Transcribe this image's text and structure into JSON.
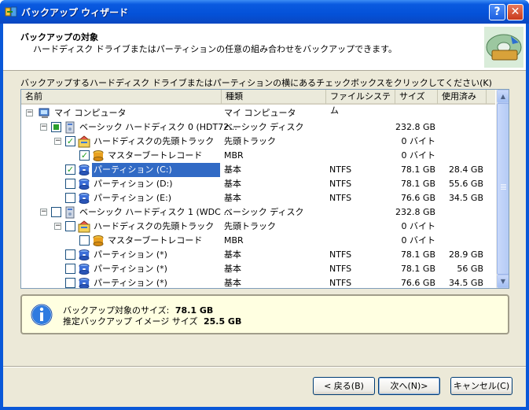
{
  "window": {
    "title": "バックアップ ウィザード",
    "help_label": "?",
    "close_label": "✕"
  },
  "header": {
    "title": "バックアップの対象",
    "subtitle": "ハードディスク ドライブまたはパーティションの任意の組み合わせをバックアップできます。"
  },
  "instruction": "バックアップするハードディスク ドライブまたはパーティションの横にあるチェックボックスをクリックしてください(K)",
  "columns": [
    "名前",
    "種類",
    "ファイルシステム",
    "サイズ",
    "使用済み"
  ],
  "rows": [
    {
      "name": "マイ コンピュータ",
      "type": "マイ コンピュータ",
      "fs": "",
      "size": "",
      "used": ""
    },
    {
      "name": "ベーシック ハードディスク 0 (HDT72...",
      "type": "ベーシック ディスク",
      "fs": "",
      "size": "232.8 GB",
      "used": ""
    },
    {
      "name": "ハードディスクの先頭トラック",
      "type": "先頭トラック",
      "fs": "",
      "size": "0 バイト",
      "used": ""
    },
    {
      "name": "マスターブートレコード",
      "type": "MBR",
      "fs": "",
      "size": "0 バイト",
      "used": ""
    },
    {
      "name": "パーティション (C:)",
      "type": "基本",
      "fs": "NTFS",
      "size": "78.1 GB",
      "used": "28.4 GB"
    },
    {
      "name": "パーティション (D:)",
      "type": "基本",
      "fs": "NTFS",
      "size": "78.1 GB",
      "used": "55.6 GB"
    },
    {
      "name": "パーティション (E:)",
      "type": "基本",
      "fs": "NTFS",
      "size": "76.6 GB",
      "used": "34.5 GB"
    },
    {
      "name": "ベーシック ハードディスク 1 (WDC ...",
      "type": "ベーシック ディスク",
      "fs": "",
      "size": "232.8 GB",
      "used": ""
    },
    {
      "name": "ハードディスクの先頭トラック",
      "type": "先頭トラック",
      "fs": "",
      "size": "0 バイト",
      "used": ""
    },
    {
      "name": "マスターブートレコード",
      "type": "MBR",
      "fs": "",
      "size": "0 バイト",
      "used": ""
    },
    {
      "name": "パーティション (*)",
      "type": "基本",
      "fs": "NTFS",
      "size": "78.1 GB",
      "used": "28.9 GB"
    },
    {
      "name": "パーティション (*)",
      "type": "基本",
      "fs": "NTFS",
      "size": "78.1 GB",
      "used": "56 GB"
    },
    {
      "name": "パーティション (*)",
      "type": "基本",
      "fs": "NTFS",
      "size": "76.6 GB",
      "used": "34.5 GB"
    }
  ],
  "checkbox_states": [
    "none",
    "partial",
    "checked",
    "checked",
    "checked",
    "unchecked",
    "unchecked",
    "unchecked",
    "unchecked",
    "unchecked",
    "unchecked",
    "unchecked",
    "unchecked"
  ],
  "selected_row": "パーティション (C:)",
  "info": {
    "line1_label": "バックアップ対象のサイズ:",
    "line1_value": "78.1 GB",
    "line2_label": "推定バックアップ イメージ サイズ",
    "line2_value": "25.5 GB"
  },
  "buttons": {
    "back": "< 戻る(B)",
    "next": "次へ(N)>",
    "cancel": "キャンセル(C)"
  },
  "colors": {
    "titlebar": "#0a5ae0",
    "selection": "#316ac5",
    "info_bg": "#ffffe1",
    "check_green": "#21a121"
  }
}
